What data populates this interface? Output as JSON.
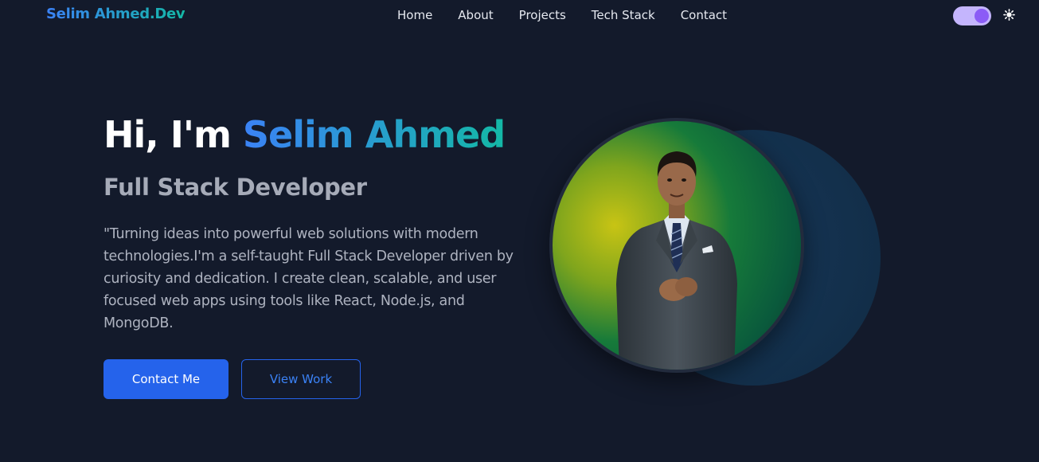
{
  "nav": {
    "logo": "Selim Ahmed.Dev",
    "links": [
      "Home",
      "About",
      "Projects",
      "Tech Stack",
      "Contact"
    ],
    "theme_toggle": {
      "state": "on"
    }
  },
  "hero": {
    "greeting": "Hi, I'm ",
    "name": "Selim Ahmed",
    "role": "Full Stack Developer",
    "description": "\"Turning ideas into powerful web solutions with modern technologies.I'm a self-taught Full Stack Developer driven by curiosity and dedication. I create clean, scalable, and user focused web apps using tools like React, Node.js, and MongoDB.",
    "primary_button": "Contact Me",
    "secondary_button": "View Work"
  },
  "colors": {
    "background": "#131a2b",
    "accent_blue": "#2563eb",
    "accent_teal": "#14b8a6",
    "toggle_track": "#c4b5fd",
    "toggle_knob": "#8b5cf6"
  },
  "icons": {
    "theme": "sun-icon",
    "profile": "profile-photo"
  }
}
